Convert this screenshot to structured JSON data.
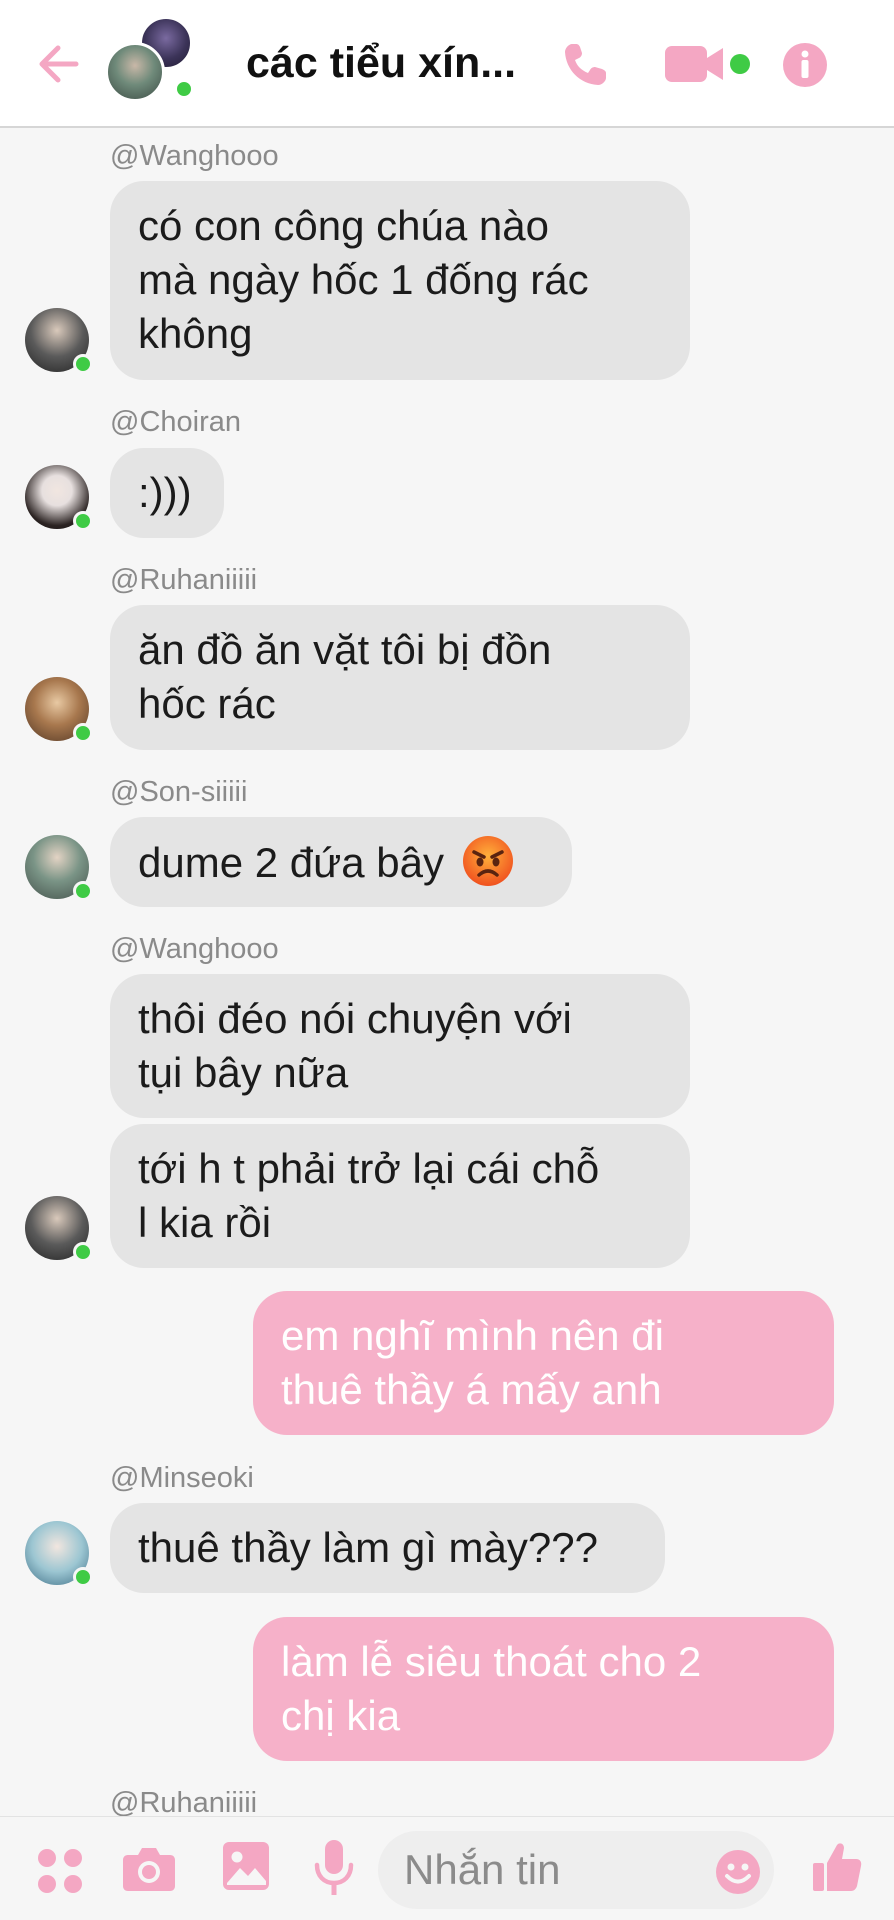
{
  "header": {
    "title": "các tiểu xín...",
    "accent_color": "#f4a7c3",
    "online_color": "#3fcb45"
  },
  "messages": [
    {
      "sender": "@Wanghooo",
      "text": "có con công chúa nào\nmà ngày hốc 1 đống rác\nkhông"
    },
    {
      "sender": "@Choiran",
      "text": ":)))"
    },
    {
      "sender": "@Ruhaniiiii",
      "text": "ăn đồ ăn vặt tôi bị đồn\nhốc rác"
    },
    {
      "sender": "@Son-siiiii",
      "text": "dume 2 đứa bây",
      "emoji": "angry-face-icon"
    },
    {
      "sender": "@Wanghooo",
      "text": "thôi đéo nói chuyện với\ntụi bây nữa"
    },
    {
      "sender": "@Wanghooo",
      "text": "tới h t phải trở lại cái chỗ\nl kia rồi"
    },
    {
      "sender": "me",
      "text": "em nghĩ mình nên đi\nthuê thầy á mấy anh"
    },
    {
      "sender": "@Minseoki",
      "text": "thuê thầy làm gì mày???"
    },
    {
      "sender": "me",
      "text": "làm lễ siêu thoát cho 2\nchị kia"
    },
    {
      "sender": "@Ruhaniiiii",
      "text": ""
    }
  ],
  "composer": {
    "placeholder": "Nhắn tin",
    "icons": [
      "apps-icon",
      "camera-icon",
      "image-icon",
      "microphone-icon",
      "emoji-icon",
      "thumbs-up-icon"
    ]
  }
}
